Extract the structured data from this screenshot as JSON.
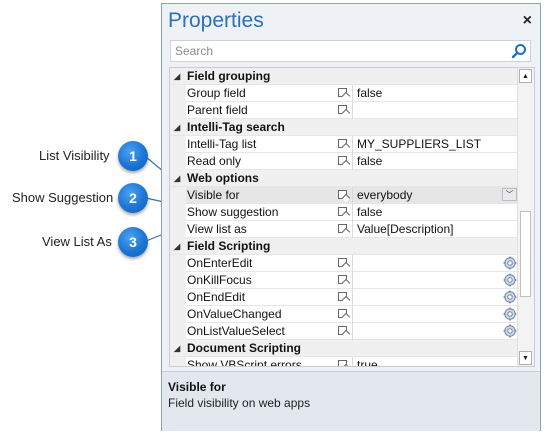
{
  "callouts": [
    {
      "num": "1",
      "label": "List Visibility"
    },
    {
      "num": "2",
      "label": "Show Suggestion"
    },
    {
      "num": "3",
      "label": "View List As"
    }
  ],
  "window": {
    "title": "Properties",
    "close": "×"
  },
  "search": {
    "placeholder": "Search"
  },
  "grid": {
    "rows": [
      {
        "type": "category",
        "name": "Field grouping"
      },
      {
        "type": "prop",
        "name": "Group field",
        "value": "false"
      },
      {
        "type": "prop",
        "name": "Parent field",
        "value": ""
      },
      {
        "type": "category",
        "name": "Intelli-Tag search"
      },
      {
        "type": "prop",
        "name": "Intelli-Tag list",
        "value": "MY_SUPPLIERS_LIST"
      },
      {
        "type": "prop",
        "name": "Read only",
        "value": "false"
      },
      {
        "type": "category",
        "name": "Web options"
      },
      {
        "type": "prop",
        "name": "Visible for",
        "value": "everybody",
        "selected": true,
        "dropdown": true
      },
      {
        "type": "prop",
        "name": "Show suggestion",
        "value": "false"
      },
      {
        "type": "prop",
        "name": "View list as",
        "value": "Value[Description]"
      },
      {
        "type": "category",
        "name": "Field Scripting"
      },
      {
        "type": "prop",
        "name": "OnEnterEdit",
        "value": "",
        "gear": true
      },
      {
        "type": "prop",
        "name": "OnKillFocus",
        "value": "",
        "gear": true
      },
      {
        "type": "prop",
        "name": "OnEndEdit",
        "value": "",
        "gear": true
      },
      {
        "type": "prop",
        "name": "OnValueChanged",
        "value": "",
        "gear": true
      },
      {
        "type": "prop",
        "name": "OnListValueSelect",
        "value": "",
        "gear": true
      },
      {
        "type": "category",
        "name": "Document Scripting"
      },
      {
        "type": "prop",
        "name": "Show VBScript errors",
        "value": "true"
      }
    ]
  },
  "description": {
    "title": "Visible for",
    "text": "Field visibility on web apps"
  }
}
